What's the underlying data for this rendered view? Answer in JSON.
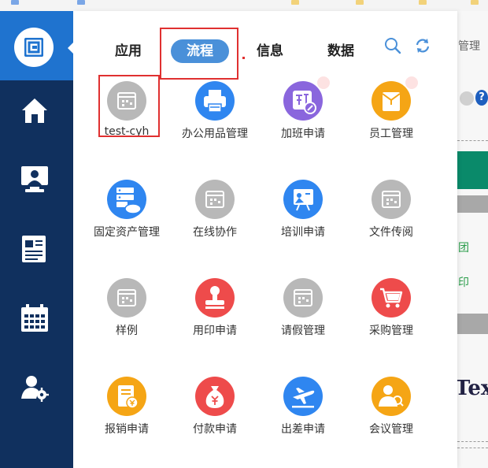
{
  "tabs": [
    {
      "label": "应用",
      "active": false
    },
    {
      "label": "流程",
      "active": true
    },
    {
      "label": "信息",
      "active": false
    },
    {
      "label": "数据",
      "active": false
    }
  ],
  "tools": {
    "search_icon": "search-icon",
    "refresh_icon": "refresh-icon"
  },
  "apps": [
    {
      "label": "test-cyh",
      "icon": "window-icon",
      "color": "#b8b8b8"
    },
    {
      "label": "办公用品管理",
      "icon": "printer-icon",
      "color": "#2f86f0"
    },
    {
      "label": "加班申请",
      "icon": "overtime-icon",
      "color": "#8a66dd"
    },
    {
      "label": "员工管理",
      "icon": "folder-icon",
      "color": "#f5a515"
    },
    {
      "label": "固定资产管理",
      "icon": "server-icon",
      "color": "#2f86f0"
    },
    {
      "label": "在线协作",
      "icon": "window-icon",
      "color": "#b8b8b8"
    },
    {
      "label": "培训申请",
      "icon": "presentation-icon",
      "color": "#2f86f0"
    },
    {
      "label": "文件传阅",
      "icon": "window-icon",
      "color": "#b8b8b8"
    },
    {
      "label": "样例",
      "icon": "window-icon",
      "color": "#b8b8b8"
    },
    {
      "label": "用印申请",
      "icon": "stamp-icon",
      "color": "#ee4b4b"
    },
    {
      "label": "请假管理",
      "icon": "window-icon",
      "color": "#b8b8b8"
    },
    {
      "label": "采购管理",
      "icon": "cart-icon",
      "color": "#ee4b4b"
    },
    {
      "label": "报销申请",
      "icon": "receipt-icon",
      "color": "#f5a515"
    },
    {
      "label": "付款申请",
      "icon": "money-bag-icon",
      "color": "#ee4b4b"
    },
    {
      "label": "出差申请",
      "icon": "plane-icon",
      "color": "#2f86f0"
    },
    {
      "label": "会议管理",
      "icon": "meeting-icon",
      "color": "#f5a515"
    }
  ],
  "sidebar": {
    "items": [
      {
        "icon": "home-icon"
      },
      {
        "icon": "monitor-user-icon"
      },
      {
        "icon": "news-icon"
      },
      {
        "icon": "calendar-icon"
      },
      {
        "icon": "user-settings-icon"
      }
    ]
  },
  "background": {
    "manage_text": "管理",
    "green_text_1": "团",
    "green_text_2": "印",
    "big_text": "Tex"
  }
}
